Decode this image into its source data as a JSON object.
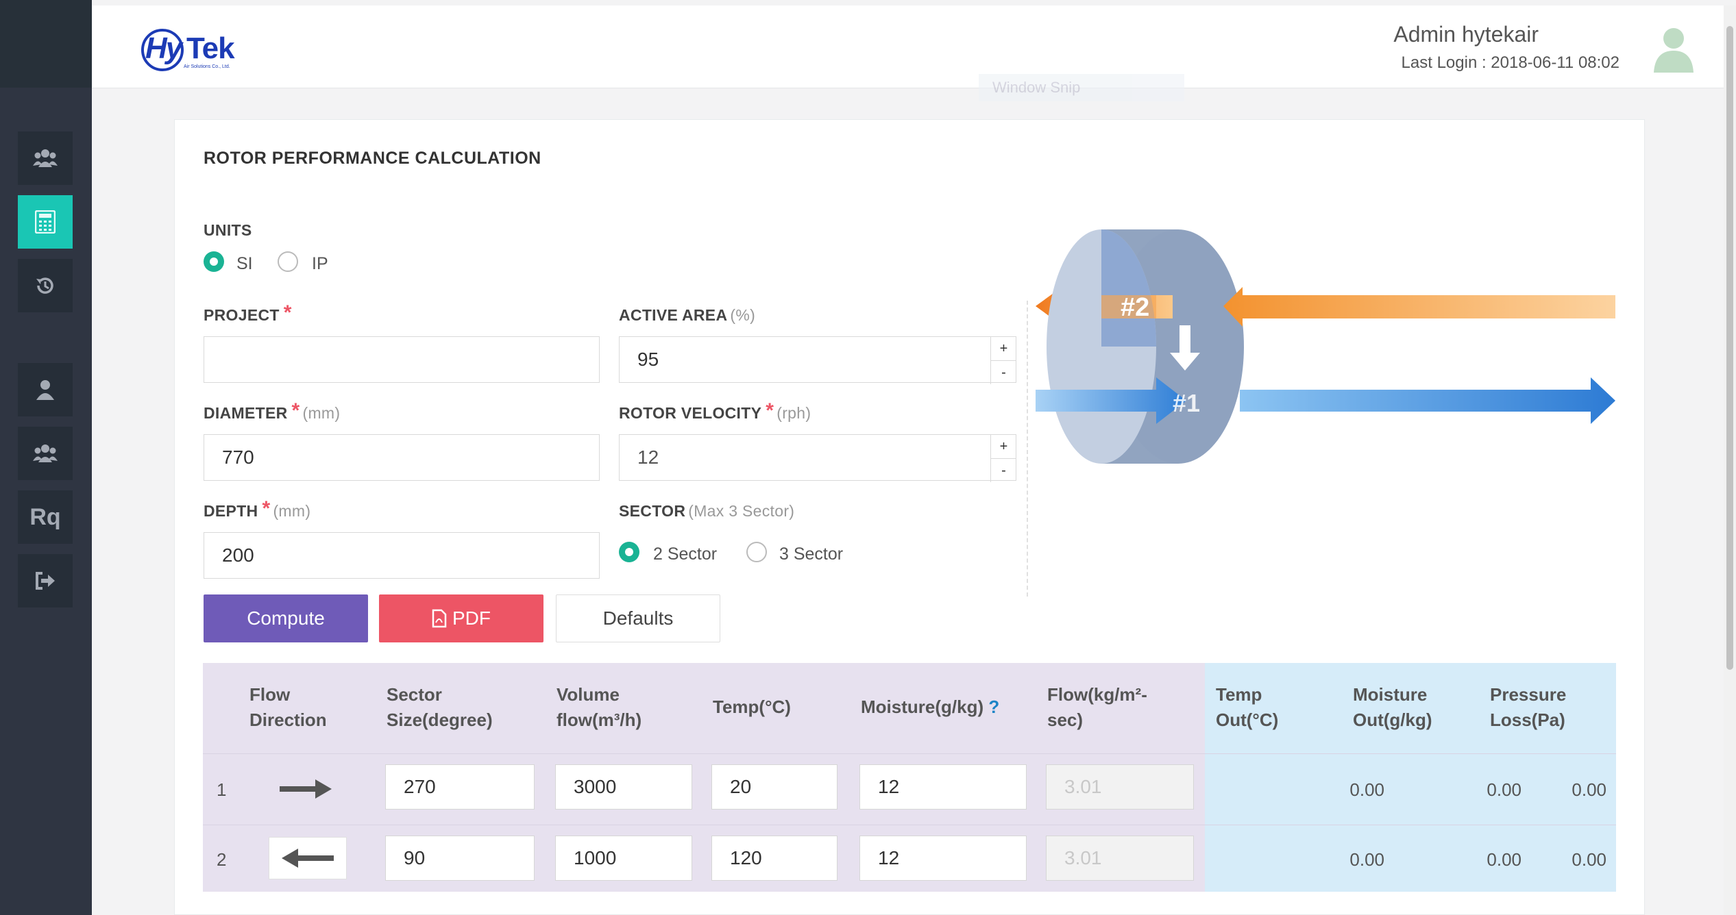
{
  "header": {
    "brand_name": "HyTek",
    "brand_hy": "Hy",
    "brand_tek": "Tek",
    "brand_sub": "Air Solutions Co., Ltd.",
    "user_name": "Admin hytekair",
    "last_login": "Last Login : 2018-06-11 08:02"
  },
  "sidebar": {
    "items": [
      {
        "name": "group",
        "icon": "users-icon"
      },
      {
        "name": "calculator",
        "icon": "calculator-icon",
        "active": true
      },
      {
        "name": "history",
        "icon": "history-icon"
      },
      {
        "name": "user",
        "icon": "user-icon"
      },
      {
        "name": "users",
        "icon": "users-icon"
      },
      {
        "name": "requests",
        "label": "Rq"
      },
      {
        "name": "logout",
        "icon": "sign-out-icon"
      }
    ]
  },
  "overlay": {
    "text": "Window Snip"
  },
  "form": {
    "title": "ROTOR PERFORMANCE CALCULATION",
    "units_label": "UNITS",
    "units_options": [
      "SI",
      "IP"
    ],
    "units_selected": "SI",
    "project_label": "PROJECT",
    "project_value": "",
    "active_area_label": "ACTIVE AREA",
    "active_area_unit": "(%)",
    "active_area_value": "95",
    "diameter_label": "DIAMETER",
    "diameter_unit": "(mm)",
    "diameter_value": "770",
    "rotor_velocity_label": "ROTOR VELOCITY",
    "rotor_velocity_unit": "(rph)",
    "rotor_velocity_value": "12",
    "depth_label": "DEPTH",
    "depth_unit": "(mm)",
    "depth_value": "200",
    "sector_label": "SECTOR",
    "sector_unit": "(Max 3 Sector)",
    "sector_options": [
      "2 Sector",
      "3 Sector"
    ],
    "sector_selected": "2 Sector",
    "required_mark": "*",
    "spin_plus": "+",
    "spin_minus": "-"
  },
  "diagram": {
    "sector_2_label": "#2",
    "sector_1_label": "#1"
  },
  "buttons": {
    "compute": "Compute",
    "pdf": "PDF",
    "defaults": "Defaults"
  },
  "table": {
    "headers": {
      "flow_direction": [
        "Flow",
        "Direction"
      ],
      "sector_size": [
        "Sector",
        "Size(degree)"
      ],
      "volume_flow": [
        "Volume",
        "flow(m³/h)"
      ],
      "temp": "Temp(°C)",
      "moisture": "Moisture(g/kg)",
      "moisture_help": "?",
      "flow_kg": [
        "Flow(kg/m²-",
        "sec)"
      ],
      "temp_out": [
        "Temp",
        "Out(°C)"
      ],
      "moisture_out": [
        "Moisture",
        "Out(g/kg)"
      ],
      "pressure_loss": [
        "Pressure",
        "Loss(Pa)"
      ]
    },
    "rows": [
      {
        "num": "1",
        "direction": "right",
        "sector_size": "270",
        "volume_flow": "3000",
        "temp": "20",
        "moisture": "12",
        "flow_kg": "3.01",
        "temp_out": "0.00",
        "moisture_out": "0.00",
        "pressure_loss": "0.00"
      },
      {
        "num": "2",
        "direction": "left",
        "sector_size": "90",
        "volume_flow": "1000",
        "temp": "120",
        "moisture": "12",
        "flow_kg": "3.01",
        "temp_out": "0.00",
        "moisture_out": "0.00",
        "pressure_loss": "0.00"
      }
    ]
  },
  "colors": {
    "sidebar": "#2f3542",
    "accent": "#1ac6b4",
    "compute": "#6f5bb8",
    "pdf": "#ed5565",
    "input_table_bg": "#e7e1ef",
    "output_table_bg": "#d6ecf9"
  }
}
